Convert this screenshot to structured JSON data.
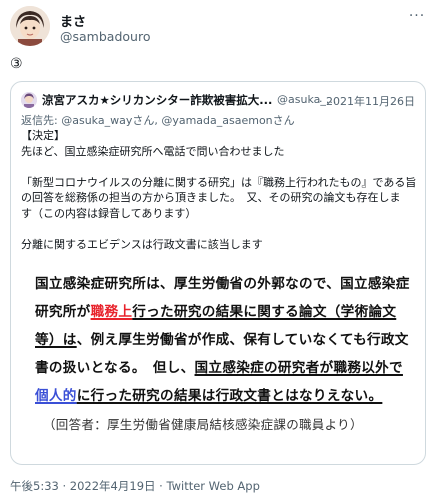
{
  "author": {
    "display_name": "まさ",
    "handle": "@sambadouro"
  },
  "tweet": {
    "text": "③"
  },
  "more_label": "···",
  "quoted": {
    "name": "涼宮アスカ★シリカンシター詐欺被害拡大...",
    "handle": "@asuka_...",
    "date": "· 2021年11月26日",
    "reply_prefix": "返信先:",
    "reply_mentions": "@asuka_wayさん, @yamada_asaemonさん",
    "body_lines": [
      "【決定】",
      "先ほど、国立感染症研究所へ電話で問い合わせました",
      "",
      "「新型コロナウイルスの分離に関する研究」は『職務上行われたもの』である旨",
      "の回答を総務係の担当の方から頂きました。　又、その研究の論文も存在しま",
      "す（この内容は録音してあります）",
      "",
      "分離に関するエビデンスは行政文書に該当します"
    ],
    "image_text": {
      "l1": "国立感染症研究所は、厚生労働省の外郭なので、国立感染症",
      "l2_a": "研究所が",
      "l2_red": "職務上",
      "l2_b": "行った研究の結果に関する論文（学術論文",
      "l3_a": "等）は",
      "l3_b": "、例え厚生労働省が作成、保有していなくても行政文",
      "l4_a": "書の扱いとなる。　但し、",
      "l4_b": "国立感染症の研究者が職務以外で",
      "l5_blue": "個人的",
      "l5_b": "に行った研究の結果は行政文書とはなりえない。",
      "l6": "（回答者：厚生労働省健康局結核感染症課の職員より）"
    }
  },
  "footer": {
    "meta": "午後5:33 · 2022年4月19日 · Twitter Web App"
  },
  "colors": {
    "secondary_text": "#536471",
    "border": "#cfd9de",
    "highlight_red": "#e8222b",
    "highlight_blue": "#3a4fd6"
  }
}
